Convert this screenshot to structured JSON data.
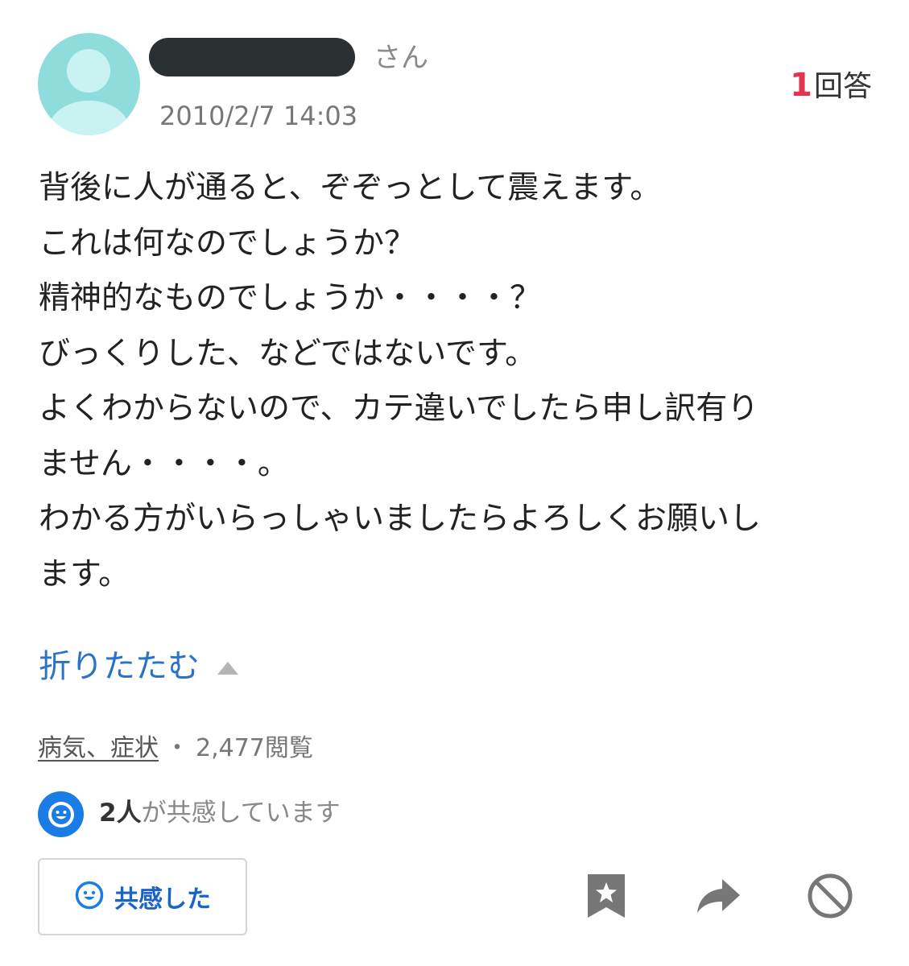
{
  "question": {
    "user_suffix": "さん",
    "date": "2010/2/7 14:03",
    "answer_count": "1",
    "answer_label": "回答",
    "lines": [
      "背後に人が通ると、ぞぞっとして震えます。",
      "これは何なのでしょうか？",
      "精神的なものでしょうか・・・・？",
      "びっくりした、などではないです。",
      "よくわからないので、カテ違いでしたら申し訳有り",
      "ません・・・・。",
      "わかる方がいらっしゃいましたらよろしくお願いし",
      "ます。"
    ],
    "collapse_label": "折りたたむ",
    "category": "病気、症状",
    "separator": "・",
    "views": "2,477閲覧",
    "empathy_count": "2人",
    "empathy_text": "が共感しています",
    "empathy_button": "共感した"
  },
  "colors": {
    "accent_blue": "#1a7de6",
    "link_blue": "#2a73c7",
    "answer_red": "#e0364f",
    "avatar": "#8fdcdc"
  },
  "icons": [
    "smile-icon",
    "bookmark-star-icon",
    "share-arrow-icon",
    "block-icon",
    "collapse-triangle-icon"
  ]
}
